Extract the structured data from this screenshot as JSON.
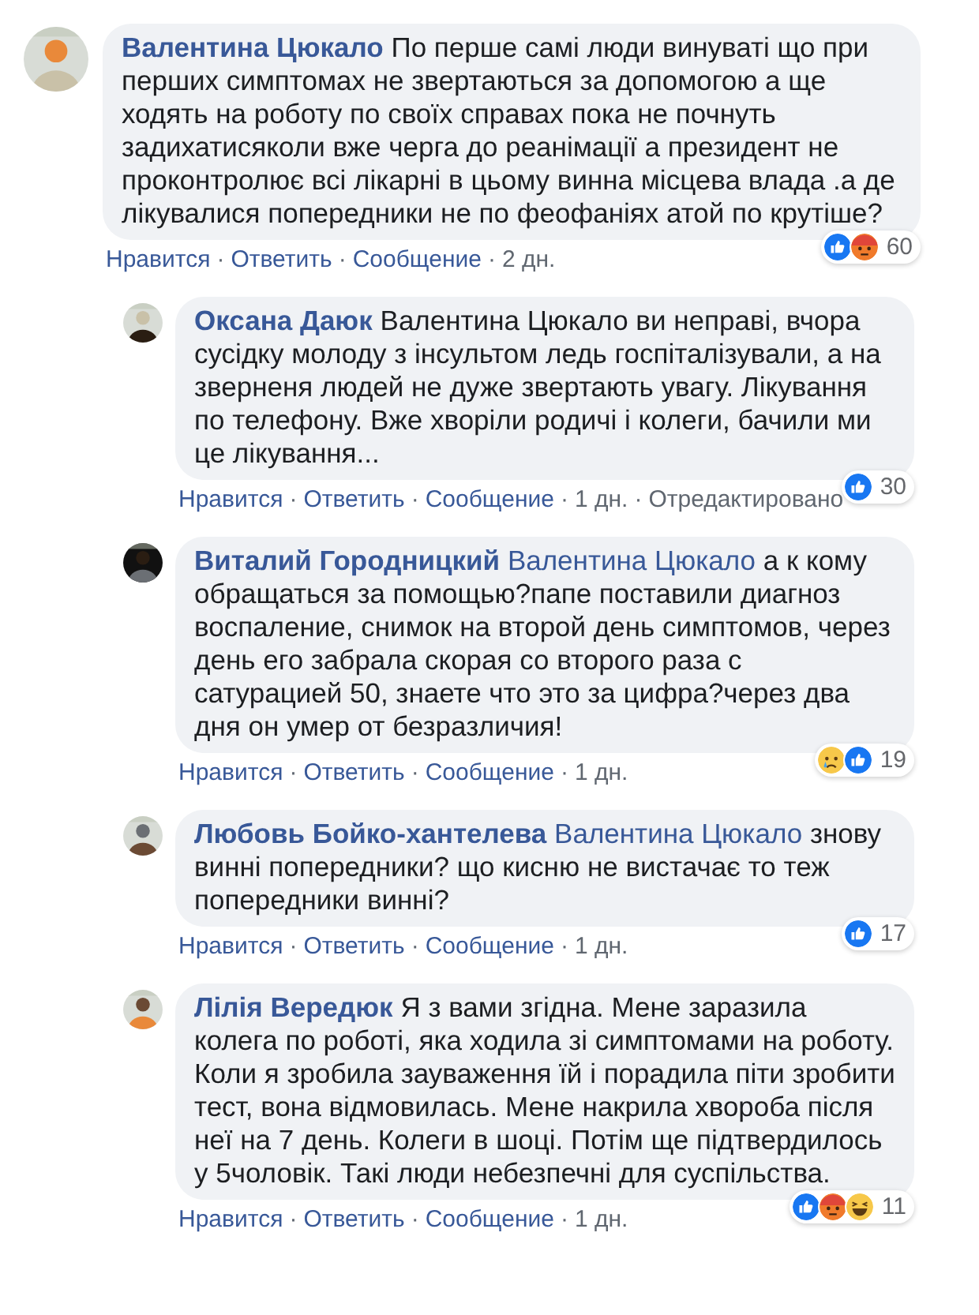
{
  "comments": [
    {
      "author": "Валентина Цюкало",
      "reply": false,
      "text": "По перше самі люди винуваті що при перших симптомах не звертаються за допомогою а ще ходять на роботу по своїх справах пока не почнуть задихатисяколи вже черга до реанімації а президент не проконтролює всі лікарні в цьому винна місцева влада .а де лікувалися попередники не по феофаніях атой по крутіше?",
      "reactions": [
        {
          "kind": "like"
        },
        {
          "kind": "angry"
        }
      ],
      "count": "60",
      "actions": [
        {
          "kind": "link",
          "text": "Нравится"
        },
        {
          "kind": "dot",
          "text": "·"
        },
        {
          "kind": "link",
          "text": "Ответить"
        },
        {
          "kind": "dot",
          "text": "·"
        },
        {
          "kind": "link",
          "text": "Сообщение"
        },
        {
          "kind": "dot",
          "text": "·"
        },
        {
          "kind": "meta",
          "text": "2 дн."
        }
      ]
    },
    {
      "author": "Оксана Даюк",
      "reply": true,
      "text": "Валентина Цюкало ви неправі, вчора сусідку молоду з інсультом ледь госпіталізували, а на зверненя людей не дуже звертають увагу. Лікування по телефону. Вже хворіли родичі і колеги, бачили ми це лікування...",
      "reactions": [
        {
          "kind": "like"
        }
      ],
      "count": "30",
      "actions": [
        {
          "kind": "link",
          "text": "Нравится"
        },
        {
          "kind": "dot",
          "text": "·"
        },
        {
          "kind": "link",
          "text": "Ответить"
        },
        {
          "kind": "dot",
          "text": "·"
        },
        {
          "kind": "link",
          "text": "Сообщение"
        },
        {
          "kind": "dot",
          "text": "·"
        },
        {
          "kind": "meta",
          "text": "1 дн."
        },
        {
          "kind": "dot",
          "text": "·"
        },
        {
          "kind": "meta",
          "text": "Отредактировано"
        }
      ]
    },
    {
      "author": "Виталий Городницкий",
      "reply": true,
      "mention": "Валентина Цюкало",
      "text": "а к кому обращаться за помощью?папе поставили диагноз воспаление, снимок на второй день симптомов, через день его забрала скорая со второго раза с сатурацией 50, знаете что это за цифра?через два дня он умер от безразличия!",
      "reactions": [
        {
          "kind": "sad"
        },
        {
          "kind": "like"
        }
      ],
      "count": "19",
      "actions": [
        {
          "kind": "link",
          "text": "Нравится"
        },
        {
          "kind": "dot",
          "text": "·"
        },
        {
          "kind": "link",
          "text": "Ответить"
        },
        {
          "kind": "dot",
          "text": "·"
        },
        {
          "kind": "link",
          "text": "Сообщение"
        },
        {
          "kind": "dot",
          "text": "·"
        },
        {
          "kind": "meta",
          "text": "1 дн."
        }
      ]
    },
    {
      "author": "Любовь Бойко-хантелева",
      "reply": true,
      "mention": "Валентина Цюкало",
      "text": "знову винні попередники?  що кисню не вистачає то теж попередники винні?",
      "reactions": [
        {
          "kind": "like"
        }
      ],
      "count": "17",
      "actions": [
        {
          "kind": "link",
          "text": "Нравится"
        },
        {
          "kind": "dot",
          "text": "·"
        },
        {
          "kind": "link",
          "text": "Ответить"
        },
        {
          "kind": "dot",
          "text": "·"
        },
        {
          "kind": "link",
          "text": "Сообщение"
        },
        {
          "kind": "dot",
          "text": "·"
        },
        {
          "kind": "meta",
          "text": "1 дн."
        }
      ]
    },
    {
      "author": "Лілія Вередюк",
      "reply": true,
      "text": "Я з вами згідна. Мене заразила колега по роботі, яка ходила зі симптомами на роботу. Коли я зробила зауваження їй і порадила піти зробити тест, вона відмовилась. Мене накрила хвороба після неї на 7 день. Колеги в шоці. Потім ще підтвердилось у 5чоловік. Такі люди небезпечні для суспільства.",
      "reactions": [
        {
          "kind": "like"
        },
        {
          "kind": "angry"
        },
        {
          "kind": "haha"
        }
      ],
      "count": "11",
      "actions": [
        {
          "kind": "link",
          "text": "Нравится"
        },
        {
          "kind": "dot",
          "text": "·"
        },
        {
          "kind": "link",
          "text": "Ответить"
        },
        {
          "kind": "dot",
          "text": "·"
        },
        {
          "kind": "link",
          "text": "Сообщение"
        },
        {
          "kind": "dot",
          "text": "·"
        },
        {
          "kind": "meta",
          "text": "1 дн."
        }
      ]
    }
  ]
}
